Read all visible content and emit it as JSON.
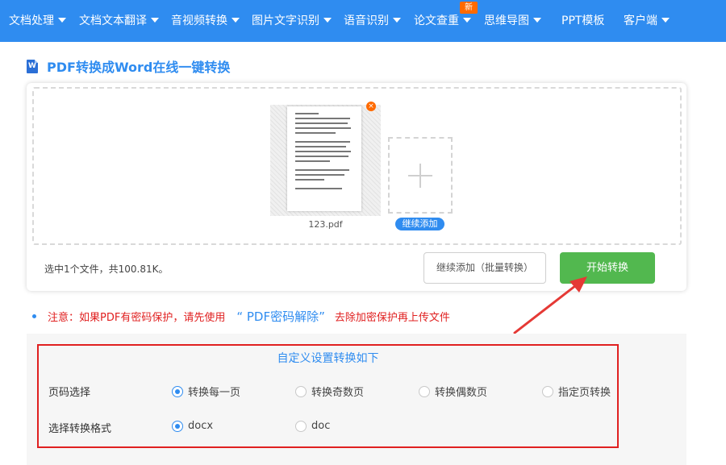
{
  "nav": {
    "items": [
      {
        "label": "文档处理",
        "dropdown": true
      },
      {
        "label": "文档文本翻译",
        "dropdown": true
      },
      {
        "label": "音视频转换",
        "dropdown": true
      },
      {
        "label": "图片文字识别",
        "dropdown": true
      },
      {
        "label": "语音识别",
        "dropdown": true
      },
      {
        "label": "论文查重",
        "dropdown": true,
        "badge": "新"
      },
      {
        "label": "思维导图",
        "dropdown": true
      },
      {
        "label": "PPT模板",
        "dropdown": false
      },
      {
        "label": "客户端",
        "dropdown": true
      }
    ]
  },
  "page": {
    "title": "PDF转换成Word在线一键转换",
    "title_icon": "W"
  },
  "upload": {
    "file_name": "123.pdf",
    "remove_icon": "×",
    "add_more_tag": "继续添加",
    "status": "选中1个文件，共100.81K。",
    "batch_add_button": "继续添加（批量转换）",
    "start_button": "开始转换"
  },
  "notice": {
    "prefix": "注意：如果PDF有密码保护，请先使用",
    "link": "“ PDF密码解除”",
    "suffix": "去除加密保护再上传文件"
  },
  "settings": {
    "title": "自定义设置转换如下",
    "page_row": {
      "label": "页码选择",
      "options": [
        {
          "label": "转换每一页",
          "selected": true
        },
        {
          "label": "转换奇数页",
          "selected": false
        },
        {
          "label": "转换偶数页",
          "selected": false
        },
        {
          "label": "指定页转换",
          "selected": false
        }
      ]
    },
    "format_row": {
      "label": "选择转换格式",
      "options": [
        {
          "label": "docx",
          "selected": true
        },
        {
          "label": "doc",
          "selected": false
        }
      ]
    }
  },
  "colors": {
    "nav_bg": "#2f8cf0",
    "accent": "#2f8cf0",
    "start_button": "#52b84f",
    "warning": "#e02020",
    "badge": "#ff6a00"
  }
}
